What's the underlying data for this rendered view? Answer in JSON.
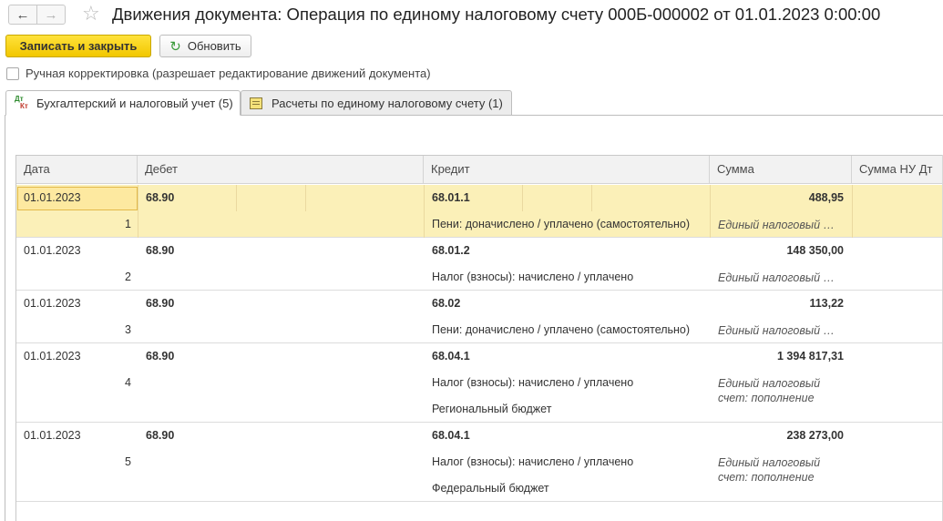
{
  "window": {
    "title": "Движения документа: Операция по единому налоговому счету 000Б-000002 от 01.01.2023 0:00:00",
    "back_icon": "arrow-left-icon",
    "forward_icon": "arrow-right-icon",
    "favorite_icon": "star-icon"
  },
  "toolbar": {
    "save_close_label": "Записать и закрыть",
    "refresh_label": "Обновить"
  },
  "manual_edit": {
    "label": "Ручная корректировка (разрешает редактирование движений документа)",
    "checked": false
  },
  "tabs": [
    {
      "label": "Бухгалтерский и налоговый учет (5)",
      "icon": "dt-kt-icon",
      "active": true
    },
    {
      "label": "Расчеты по единому налоговому счету (1)",
      "icon": "document-icon",
      "active": false
    }
  ],
  "table": {
    "columns": [
      "Дата",
      "Дебет",
      "Кредит",
      "Сумма",
      "Сумма НУ Дт"
    ],
    "rows": [
      {
        "date": "01.01.2023",
        "num": "1",
        "debit": "68.90",
        "credit": "68.01.1",
        "credit_sub1": "Пени: доначислено / уплачено (самостоятельно)",
        "credit_sub2": "",
        "sum": "488,95",
        "sum_text": "Единый налоговый …",
        "selected": true
      },
      {
        "date": "01.01.2023",
        "num": "2",
        "debit": "68.90",
        "credit": "68.01.2",
        "credit_sub1": "Налог (взносы): начислено / уплачено",
        "credit_sub2": "",
        "sum": "148 350,00",
        "sum_text": "Единый налоговый …",
        "selected": false
      },
      {
        "date": "01.01.2023",
        "num": "3",
        "debit": "68.90",
        "credit": "68.02",
        "credit_sub1": "Пени: доначислено / уплачено (самостоятельно)",
        "credit_sub2": "",
        "sum": "113,22",
        "sum_text": "Единый налоговый …",
        "selected": false
      },
      {
        "date": "01.01.2023",
        "num": "4",
        "debit": "68.90",
        "credit": "68.04.1",
        "credit_sub1": "Налог (взносы): начислено / уплачено",
        "credit_sub2": "Региональный бюджет",
        "sum": "1 394 817,31",
        "sum_text": "Единый налоговый счет: пополнение",
        "selected": false
      },
      {
        "date": "01.01.2023",
        "num": "5",
        "debit": "68.90",
        "credit": "68.04.1",
        "credit_sub1": "Налог (взносы): начислено / уплачено",
        "credit_sub2": "Федеральный бюджет",
        "sum": "238 273,00",
        "sum_text": "Единый налоговый счет: пополнение",
        "selected": false
      }
    ]
  },
  "colors": {
    "save_button": "#f5cd00",
    "selected_row": "#fbf0b8",
    "refresh_icon": "#3a9a3a"
  }
}
